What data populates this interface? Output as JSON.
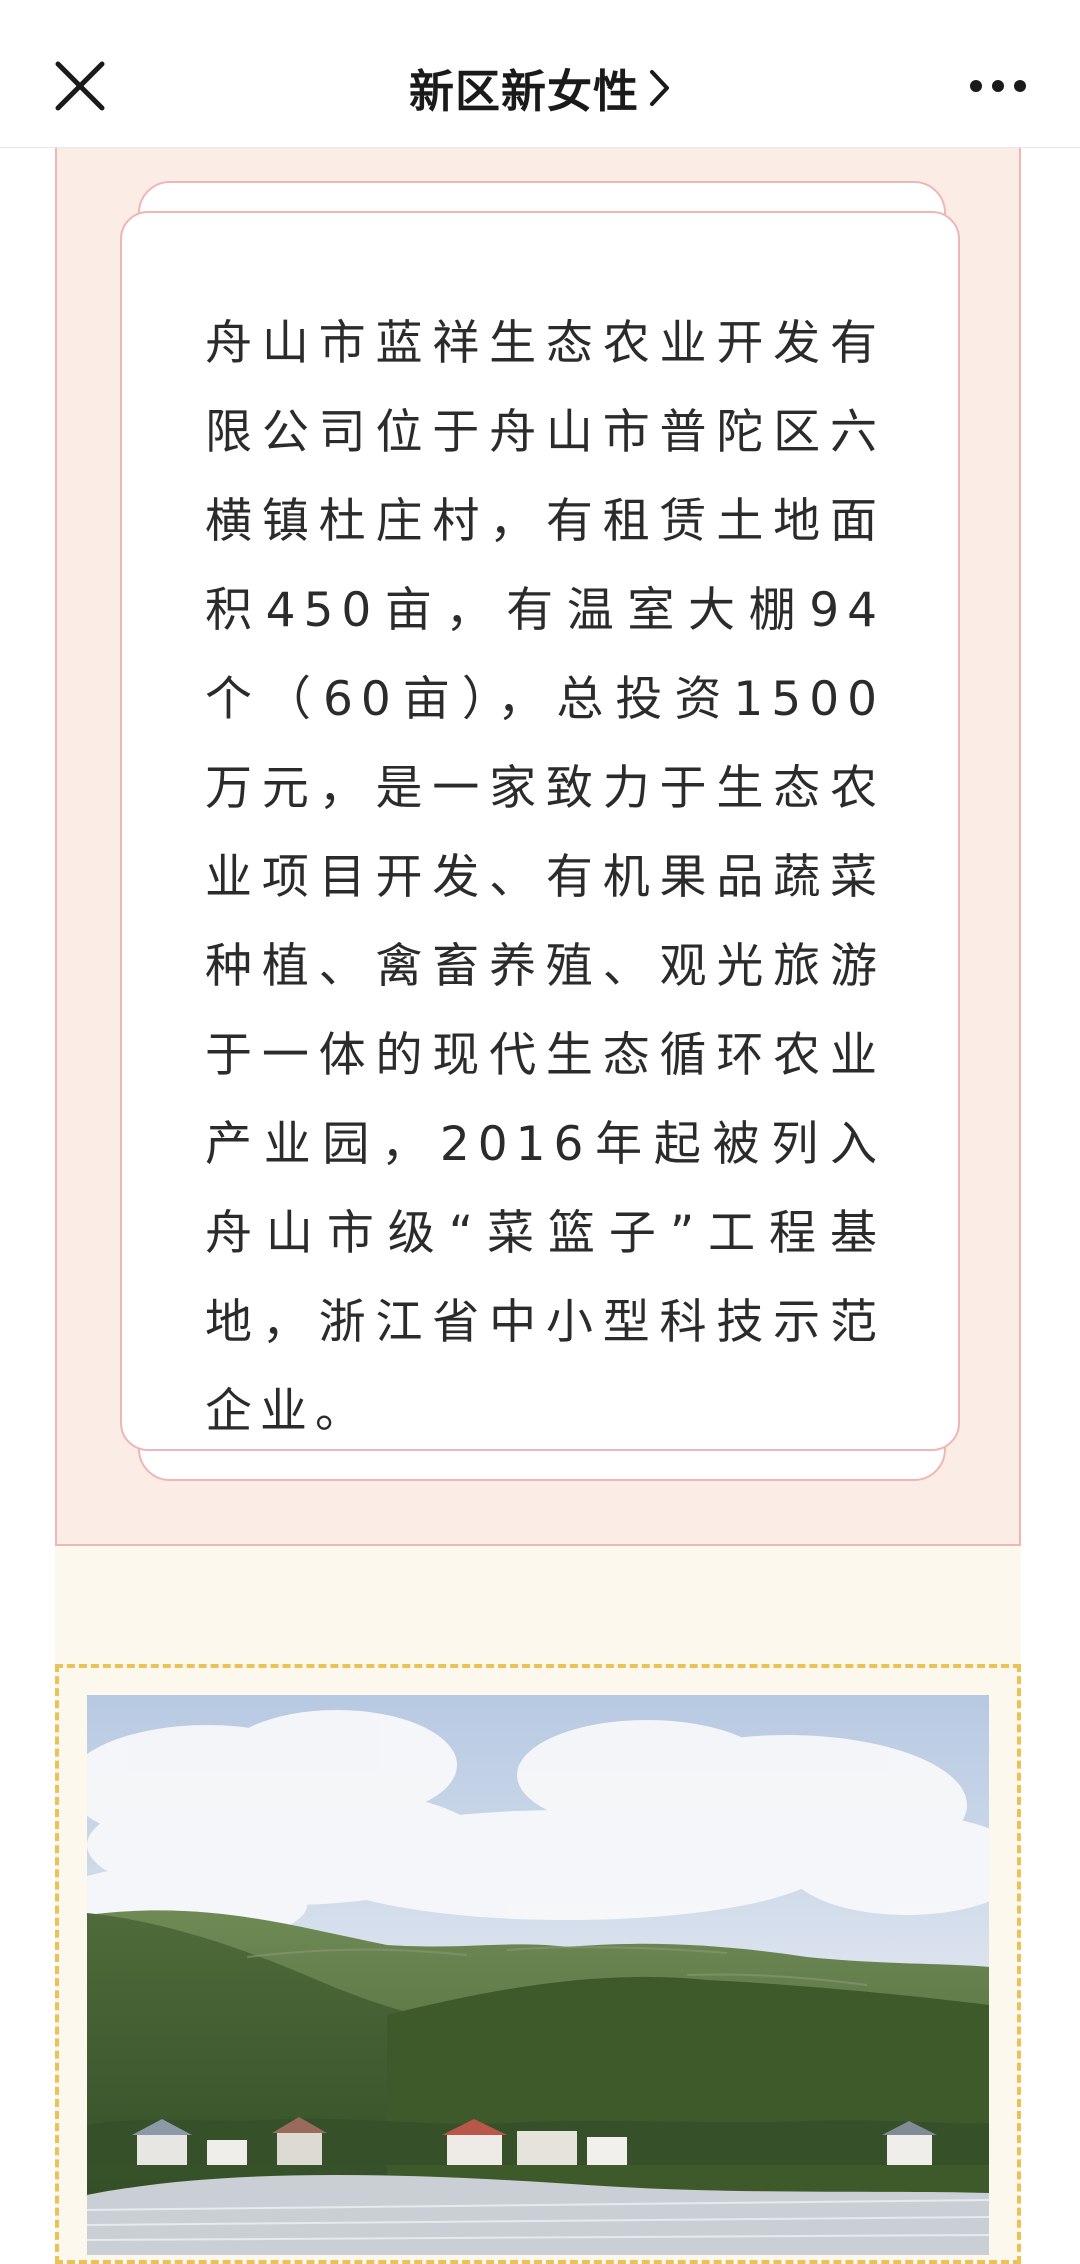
{
  "navbar": {
    "title": "新区新女性",
    "close_icon": "close-icon",
    "chevron_icon": "chevron-right-icon",
    "more_icon": "more-horizontal-icon"
  },
  "article": {
    "intro_paragraph": "舟山市蓝祥生态农业开发有限公司位于舟山市普陀区六横镇杜庄村，有租赁土地面积450亩，有温室大棚94个（60亩），总投资1500万元，是一家致力于生态农业项目开发、有机果品蔬菜种植、禽畜养殖、观光旅游于一体的现代生态循环农业产业园，2016年起被列入舟山市级“菜篮子”工程基地，浙江省中小型科技示范企业。",
    "photo_subject": "farm-landscape-photo"
  },
  "colors": {
    "pink_background": "#fbece5",
    "pink_border": "#efb6b8",
    "cream_background": "#fcf8ee",
    "dashed_border": "#ecc257",
    "text": "#2b2b2b"
  }
}
